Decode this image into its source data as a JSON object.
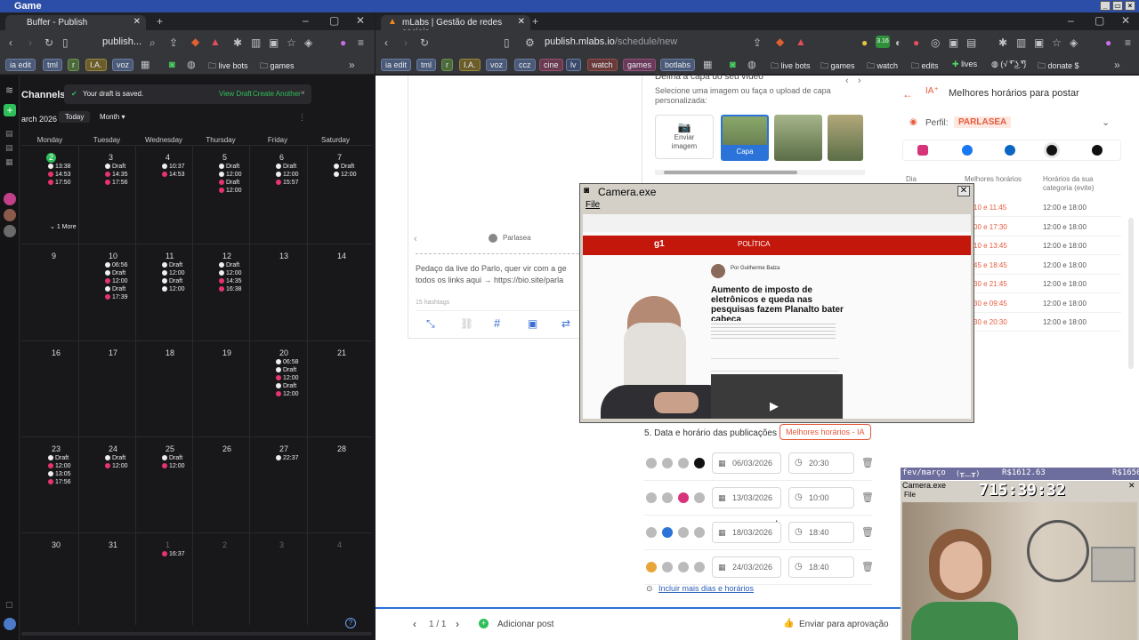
{
  "os": {
    "title": "Game"
  },
  "left_window": {
    "tab_title": "Buffer - Publish",
    "url": "publish...",
    "bookmarks": [
      "ia edit",
      "tml",
      "r",
      "I.A.",
      "voz",
      "live bots",
      "games"
    ]
  },
  "right_window": {
    "tab_title": "mLabs | Gestão de redes sociais",
    "url_host": "publish.mlabs.io",
    "url_path": "/schedule/new",
    "bookmarks": [
      "ia edit",
      "tml",
      "r",
      "I.A.",
      "voz",
      "ccz",
      "cine",
      "lv",
      "watch",
      "games",
      "botlabs",
      "live bots",
      "games",
      "watch",
      "edits",
      "lives",
      "(√ ͡❛ ͜ʖ ͡❛)",
      "donate $"
    ],
    "badge_count": "3.16"
  },
  "buffer": {
    "channels_label": "Channels",
    "toast": {
      "message": "Your draft is saved.",
      "view_draft": "View Draft",
      "create_another": "Create Another"
    },
    "month": "arch 2026",
    "today_button": "Today",
    "view_select": "Month",
    "weekdays": [
      "Monday",
      "Tuesday",
      "Wednesday",
      "Thursday",
      "Friday",
      "Saturday"
    ],
    "weeks": [
      [
        "2",
        "3",
        "4",
        "5",
        "6",
        "7"
      ],
      [
        "9",
        "10",
        "11",
        "12",
        "13",
        "14"
      ],
      [
        "16",
        "17",
        "18",
        "19",
        "20",
        "21"
      ],
      [
        "23",
        "24",
        "25",
        "26",
        "27",
        "28"
      ],
      [
        "30",
        "31",
        "1",
        "2",
        "3",
        "4"
      ]
    ],
    "more_label": "1 More",
    "events": {
      "w1_mon": [
        "13:38",
        "14:53",
        "17:50"
      ],
      "w1_tue": [
        "Draft",
        "14:35",
        "17:56"
      ],
      "w1_tue_draft_time": "12:00",
      "w1_wed": [
        "10:37",
        "14:53"
      ],
      "w1_thu": [
        "Draft",
        "12:00",
        "Draft",
        "12:00"
      ],
      "w1_fri": [
        "Draft",
        "12:00",
        "15:57"
      ],
      "w1_sat": [
        "Draft",
        "12:00"
      ],
      "w2_tue": [
        "06:56",
        "Draft",
        "12:00",
        "Draft",
        "17:39"
      ],
      "w2_wed": [
        "Draft",
        "12:00",
        "Draft",
        "12:00"
      ],
      "w2_thu": [
        "Draft",
        "12:00",
        "14:35",
        "16:38"
      ],
      "w3_fri": [
        "06:58",
        "Draft",
        "12:00",
        "Draft",
        "12:00"
      ],
      "w4_mon": [
        "Draft",
        "12:00",
        "13:05",
        "17:56"
      ],
      "w4_tue": [
        "Draft",
        "12:00"
      ],
      "w4_wed": [
        "Draft",
        "12:00"
      ],
      "w4_fri": [
        "22:37"
      ],
      "w5_wed": [
        "16:37"
      ]
    }
  },
  "mlabs": {
    "cover": {
      "title": "Defina a capa do seu vídeo",
      "subtitle": "Selecione uma imagem ou faça o upload de capa personalizada:",
      "send_image": "Enviar imagem",
      "cover_label": "Capa"
    },
    "preview": {
      "profile": "Parlasea",
      "caption_line1": "Pedaço da live do Parlo, quer vir com a ge",
      "caption_line2": "todos os links aqui → https://bio.site/parla",
      "hashtags": "15 hashtags"
    },
    "ai_panel": {
      "title": "Melhores horários para postar",
      "profile_label": "Perfil:",
      "profile_value": "PARLASEA",
      "col_day": "Dia",
      "col_best": "Melhores horários",
      "col_avoid": "Horários da sua categoria (evite)",
      "rows": [
        {
          "best": "10 e 11:45",
          "avoid": "12:00 e 18:00"
        },
        {
          "best": "00 e 17:30",
          "avoid": "12:00 e 18:00"
        },
        {
          "best": "10 e 13:45",
          "avoid": "12:00 e 18:00"
        },
        {
          "best": "45 e 18:45",
          "avoid": "12:00 e 18:00"
        },
        {
          "best": "30 e 21:45",
          "avoid": "12:00 e 18:00"
        },
        {
          "best": "30 e 09:45",
          "avoid": "12:00 e 18:00"
        },
        {
          "best": "30 e 20:30",
          "avoid": "12:00 e 18:00"
        }
      ]
    },
    "schedule": {
      "heading": "5. Data e horário das publicações",
      "best_button": "Melhores horários - IA",
      "rows": [
        {
          "date": "06/03/2026",
          "time": "20:30"
        },
        {
          "date": "13/03/2026",
          "time": "10:00"
        },
        {
          "date": "18/03/2026",
          "time": "18:40"
        },
        {
          "date": "24/03/2026",
          "time": "18:40"
        }
      ],
      "add_more": "Incluir mais dias e horários"
    },
    "footer": {
      "pager": "1 / 1",
      "add_post": "Adicionar post",
      "send_approval": "Enviar para aprovação"
    }
  },
  "camera": {
    "title": "Camera.exe",
    "menu": "File",
    "article": {
      "section": "POLÍTICA",
      "byline": "Por Guilherme Balza",
      "headline": "Aumento de imposto de eletrônicos e queda nas pesquisas fazem Planalto bater cabeça"
    }
  },
  "overlay": {
    "label": "fev/março",
    "amount": "R$1612.63",
    "amount2": "R$1650",
    "cam_title": "Camera.exe",
    "menu": "File",
    "timer": "715:39:32"
  }
}
